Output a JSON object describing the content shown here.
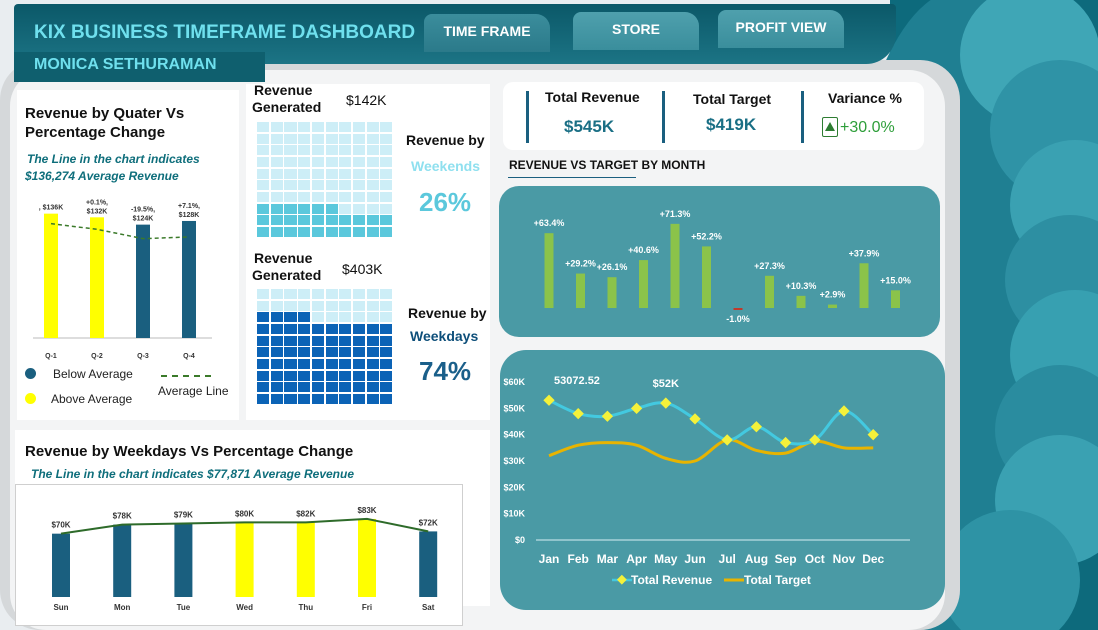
{
  "header": {
    "title": "KIX BUSINESS TIMEFRAME DASHBOARD",
    "author": "MONICA SETHURAMAN",
    "tabs": [
      {
        "label": "TIME FRAME"
      },
      {
        "label": "STORE"
      },
      {
        "label": "PROFIT VIEW"
      }
    ]
  },
  "colors": {
    "header_bg": "#0f5f6e",
    "panel_teal": "#4a9aa5",
    "bar_dark": "#1a5f7f",
    "bar_yellow": "#ffff00",
    "bar_green": "#8bc34a",
    "weekend_cell": "#5bc8dc",
    "weekday_cell": "#0b63b6",
    "target_line": "#e8b400",
    "revenue_line": "#43c9e0"
  },
  "kpis": {
    "total_revenue": {
      "label": "Total Revenue",
      "value": "$545K"
    },
    "total_target": {
      "label": "Total Target",
      "value": "$419K"
    },
    "variance": {
      "label": "Variance %",
      "value": "+30.0%",
      "icon": "up-triangle-icon"
    }
  },
  "quarter_panel": {
    "title_line1": "Revenue by Quater Vs",
    "title_line2": "Percentage Change",
    "note_line1": "The Line in the chart indicates",
    "note_line2": "$136,274 Average Revenue",
    "legend_below": "Below Average",
    "legend_above": "Above Average",
    "legend_line": "Average Line"
  },
  "waffle": {
    "weekend": {
      "generated_l1": "Revenue",
      "generated_l2": "Generated",
      "amount": "$142K",
      "by_l1": "Revenue by",
      "by_l2": "Weekends",
      "percent": "26%"
    },
    "weekday": {
      "generated_l1": "Revenue",
      "generated_l2": "Generated",
      "amount": "$403K",
      "by_l1": "Revenue by",
      "by_l2": "Weekdays",
      "percent": "74%"
    }
  },
  "weekday_panel": {
    "title": "Revenue by Weekdays Vs Percentage Change",
    "note": "The Line in the chart indicates $77,871 Average Revenue"
  },
  "rvt_title": "REVENUE VS TARGET BY MONTH",
  "chart_data": [
    {
      "id": "quarter",
      "type": "bar",
      "categories": [
        "Q-1",
        "Q-2",
        "Q-3",
        "Q-4"
      ],
      "values": [
        136,
        132,
        124,
        128
      ],
      "labels": [
        ", $136K",
        "+0.1%, $132K",
        "-19.5%, $124K",
        "+7.1%, $128K"
      ],
      "above_average": [
        true,
        true,
        false,
        false
      ],
      "average": 136.274,
      "ylim": [
        0,
        140
      ]
    },
    {
      "id": "weekday",
      "type": "bar",
      "categories": [
        "Sun",
        "Mon",
        "Tue",
        "Wed",
        "Thu",
        "Fri",
        "Sat"
      ],
      "values": [
        70,
        78,
        79,
        80,
        80,
        83,
        72
      ],
      "labels": [
        "$70K",
        "$78K",
        "$79K",
        "$80K",
        "$82K",
        "$83K",
        "$72K"
      ],
      "above_average": [
        false,
        false,
        false,
        true,
        true,
        true,
        false
      ],
      "average": 77.871,
      "ylim": [
        0,
        90
      ]
    },
    {
      "id": "variance_month",
      "type": "bar",
      "categories": [
        "Jan",
        "Feb",
        "Mar",
        "Apr",
        "May",
        "Jun",
        "Jul",
        "Aug",
        "Sep",
        "Oct",
        "Nov",
        "Dec"
      ],
      "values": [
        63.4,
        29.2,
        26.1,
        40.6,
        71.3,
        52.2,
        -1.0,
        27.3,
        10.3,
        2.9,
        37.9,
        15.0
      ],
      "labels": [
        "+63.4%",
        "+29.2%",
        "+26.1%",
        "+40.6%",
        "+71.3%",
        "+52.2%",
        "-1.0%",
        "+27.3%",
        "+10.3%",
        "+2.9%",
        "+37.9%",
        "+15.0%"
      ]
    },
    {
      "id": "revenue_target",
      "type": "line",
      "categories": [
        "Jan",
        "Feb",
        "Mar",
        "Apr",
        "May",
        "Jun",
        "Jul",
        "Aug",
        "Sep",
        "Oct",
        "Nov",
        "Dec"
      ],
      "yticks": [
        "$0",
        "$10K",
        "$20K",
        "$30K",
        "$40K",
        "$50K",
        "$60K"
      ],
      "ylim": [
        0,
        60000
      ],
      "series": [
        {
          "name": "Total Revenue",
          "values": [
            53072.52,
            48000,
            47000,
            50000,
            52000,
            46000,
            38000,
            43000,
            37000,
            38000,
            49000,
            40000
          ]
        },
        {
          "name": "Total Target",
          "values": [
            32000,
            36000,
            37000,
            36000,
            31000,
            30000,
            38000,
            34000,
            33000,
            37500,
            35000,
            35000
          ]
        }
      ],
      "annotations": [
        {
          "index": 0,
          "text": "53072.52"
        },
        {
          "index": 4,
          "text": "$52K"
        }
      ]
    }
  ]
}
